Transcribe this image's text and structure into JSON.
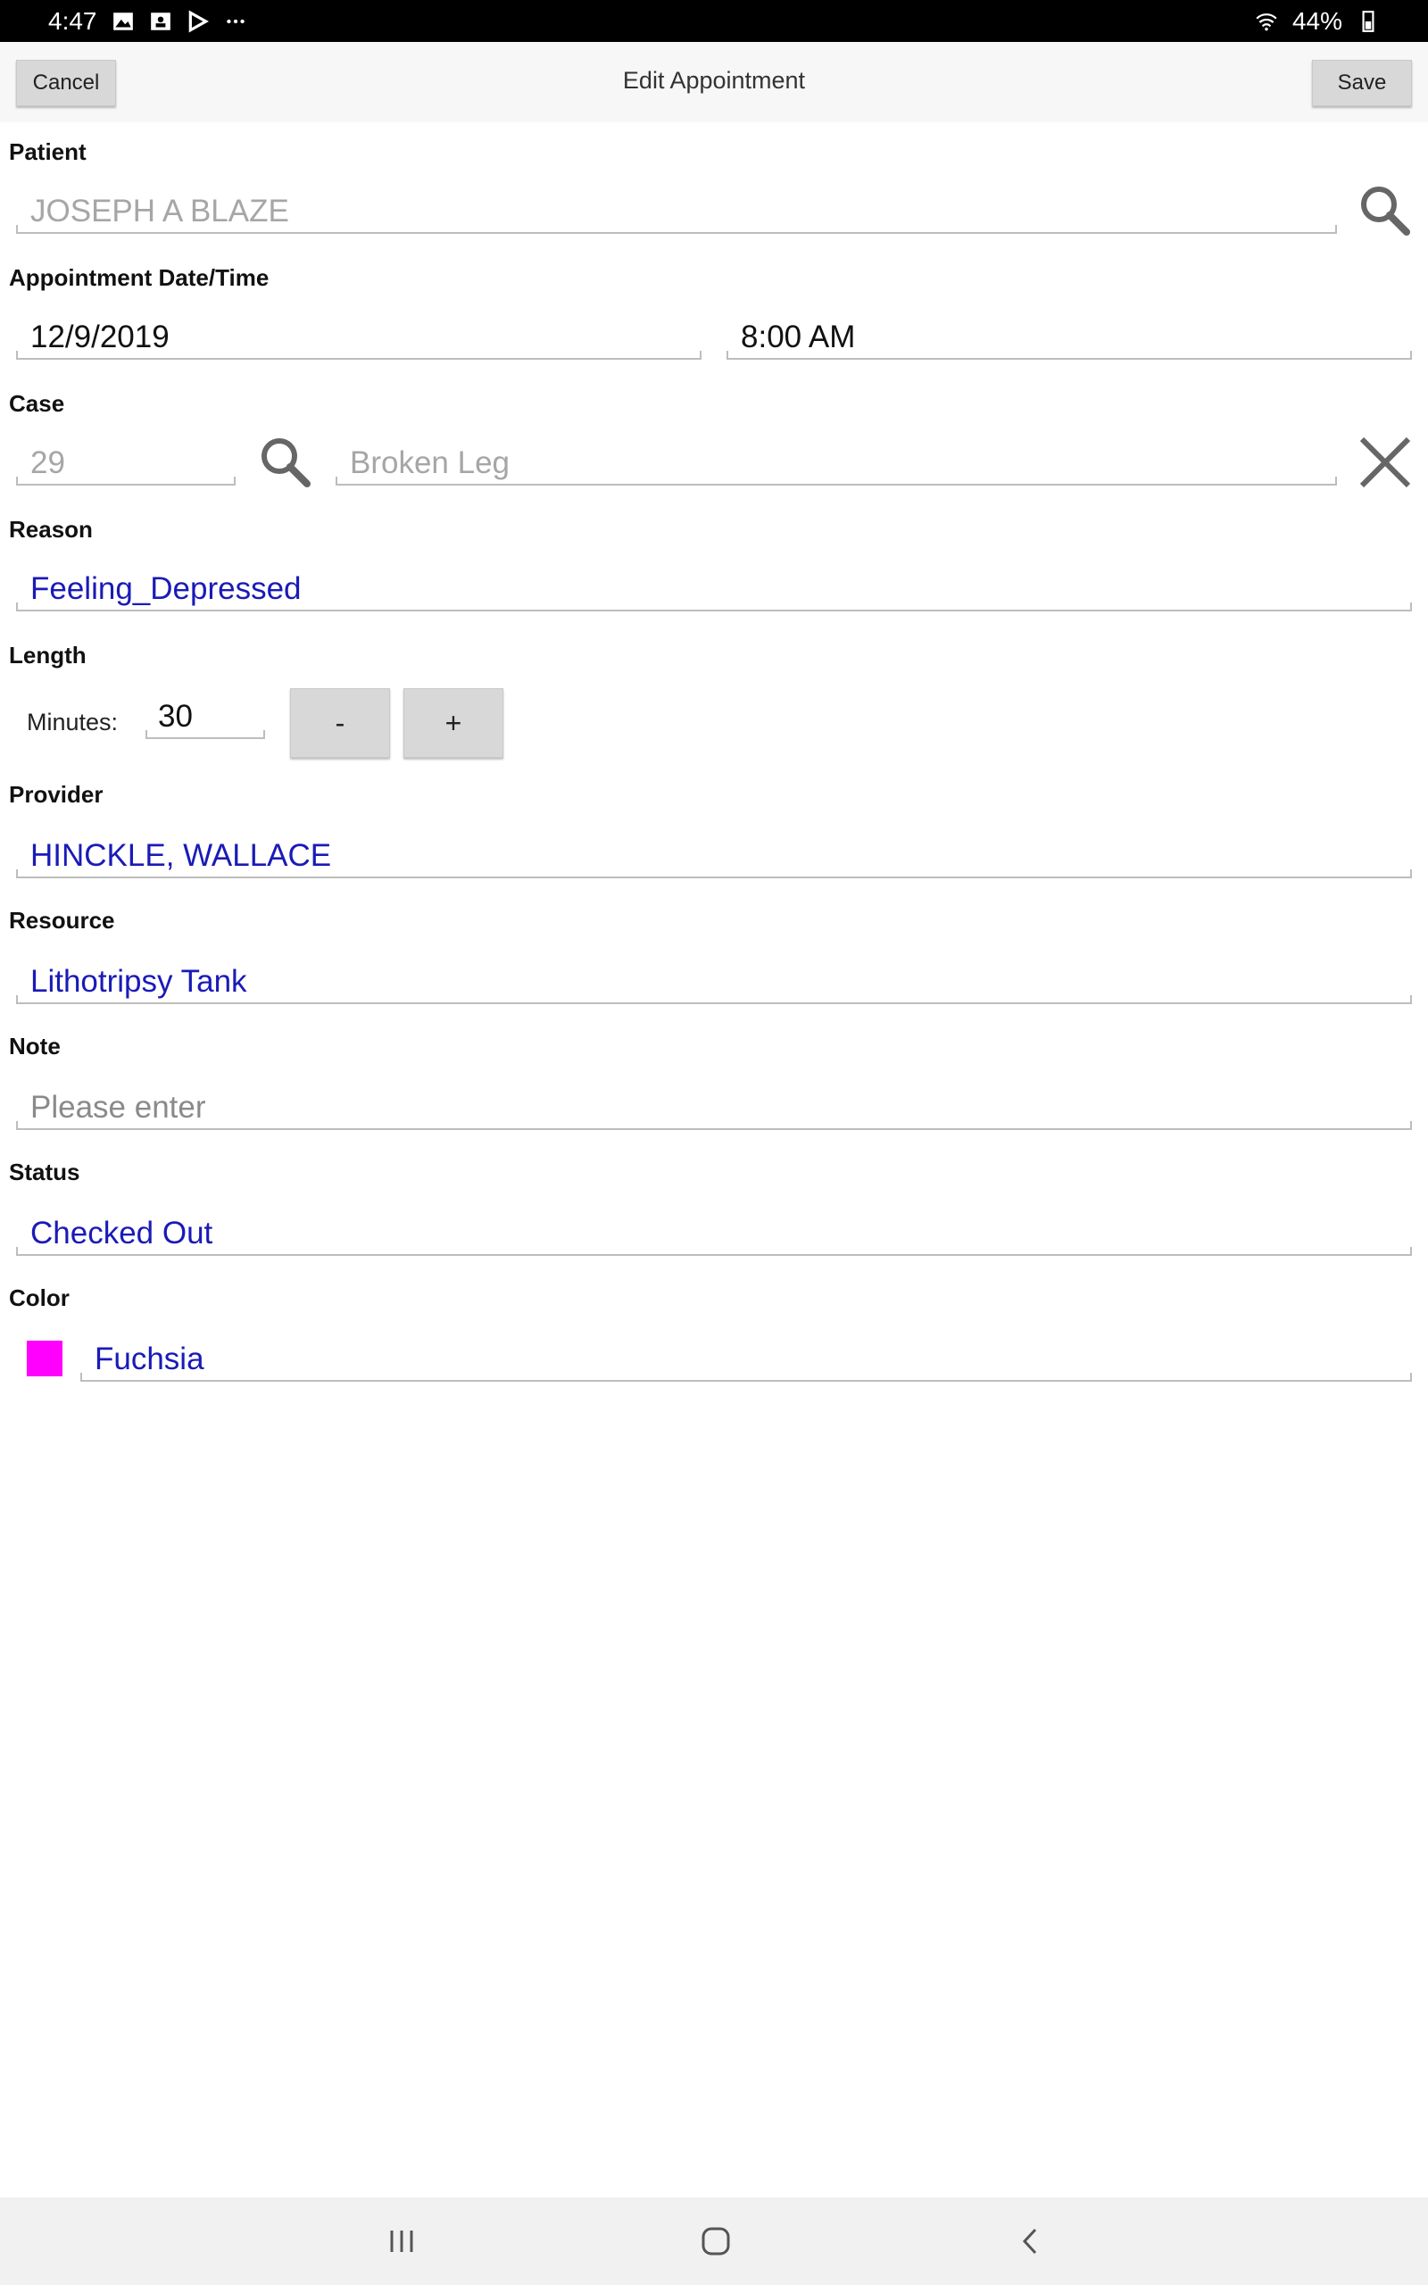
{
  "status_bar": {
    "time": "4:47",
    "battery": "44%",
    "icons": [
      "gallery-icon",
      "contact-card-icon",
      "play-store-icon",
      "more-dots-icon",
      "wifi-icon",
      "battery-icon"
    ]
  },
  "toolbar": {
    "cancel_label": "Cancel",
    "title": "Edit Appointment",
    "save_label": "Save"
  },
  "form": {
    "patient": {
      "label": "Patient",
      "value": "JOSEPH A BLAZE"
    },
    "appointment": {
      "label": "Appointment Date/Time",
      "date": "12/9/2019",
      "time": "8:00 AM"
    },
    "case": {
      "label": "Case",
      "number": "29",
      "description": "Broken Leg"
    },
    "reason": {
      "label": "Reason",
      "value": "Feeling_Depressed"
    },
    "length": {
      "label": "Length",
      "minutes_label": "Minutes:",
      "minutes": "30",
      "minus_label": "-",
      "plus_label": "+"
    },
    "provider": {
      "label": "Provider",
      "value": "HINCKLE, WALLACE"
    },
    "resource": {
      "label": "Resource",
      "value": "Lithotripsy Tank"
    },
    "note": {
      "label": "Note",
      "placeholder": "Please enter"
    },
    "status": {
      "label": "Status",
      "value": "Checked Out"
    },
    "color": {
      "label": "Color",
      "value": "Fuchsia",
      "swatch": "#ff00ff"
    }
  },
  "colors": {
    "accent_text": "#1a1ab8",
    "button_bg": "#d8d8d8",
    "status_bar_bg": "#000000"
  }
}
